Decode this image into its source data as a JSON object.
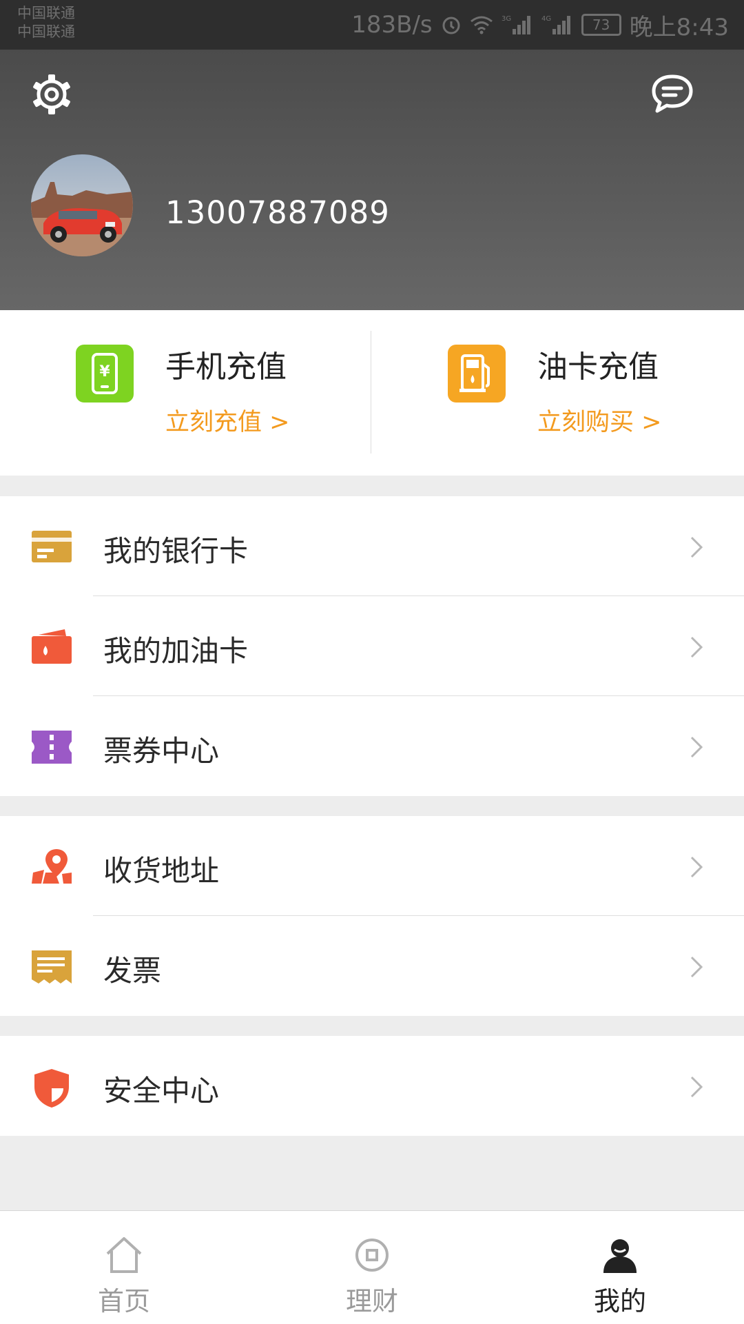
{
  "status_bar": {
    "carrier1": "中国联通",
    "carrier2": "中国联通",
    "speed": "183B/s",
    "network1": "3G",
    "network2": "4G",
    "battery": "73",
    "time": "晚上8:43"
  },
  "header": {
    "settings_icon": "gear-icon",
    "message_icon": "message-icon",
    "phone_number": "13007887089"
  },
  "recharge": {
    "phone": {
      "title": "手机充值",
      "link": "立刻充值 >",
      "icon": "phone-recharge-icon",
      "color": "#7ed321"
    },
    "fuel": {
      "title": "油卡充值",
      "link": "立刻购买 >",
      "icon": "fuel-pump-icon",
      "color": "#f6a623"
    }
  },
  "menu": {
    "bank_card": "我的银行卡",
    "fuel_card": "我的加油卡",
    "tickets": "票券中心",
    "address": "收货地址",
    "invoice": "发票",
    "security": "安全中心"
  },
  "nav": {
    "home": "首页",
    "finance": "理财",
    "mine": "我的"
  },
  "colors": {
    "accent": "#f39a1e",
    "header_top": "#4b4b4b",
    "header_bottom": "#676767"
  }
}
